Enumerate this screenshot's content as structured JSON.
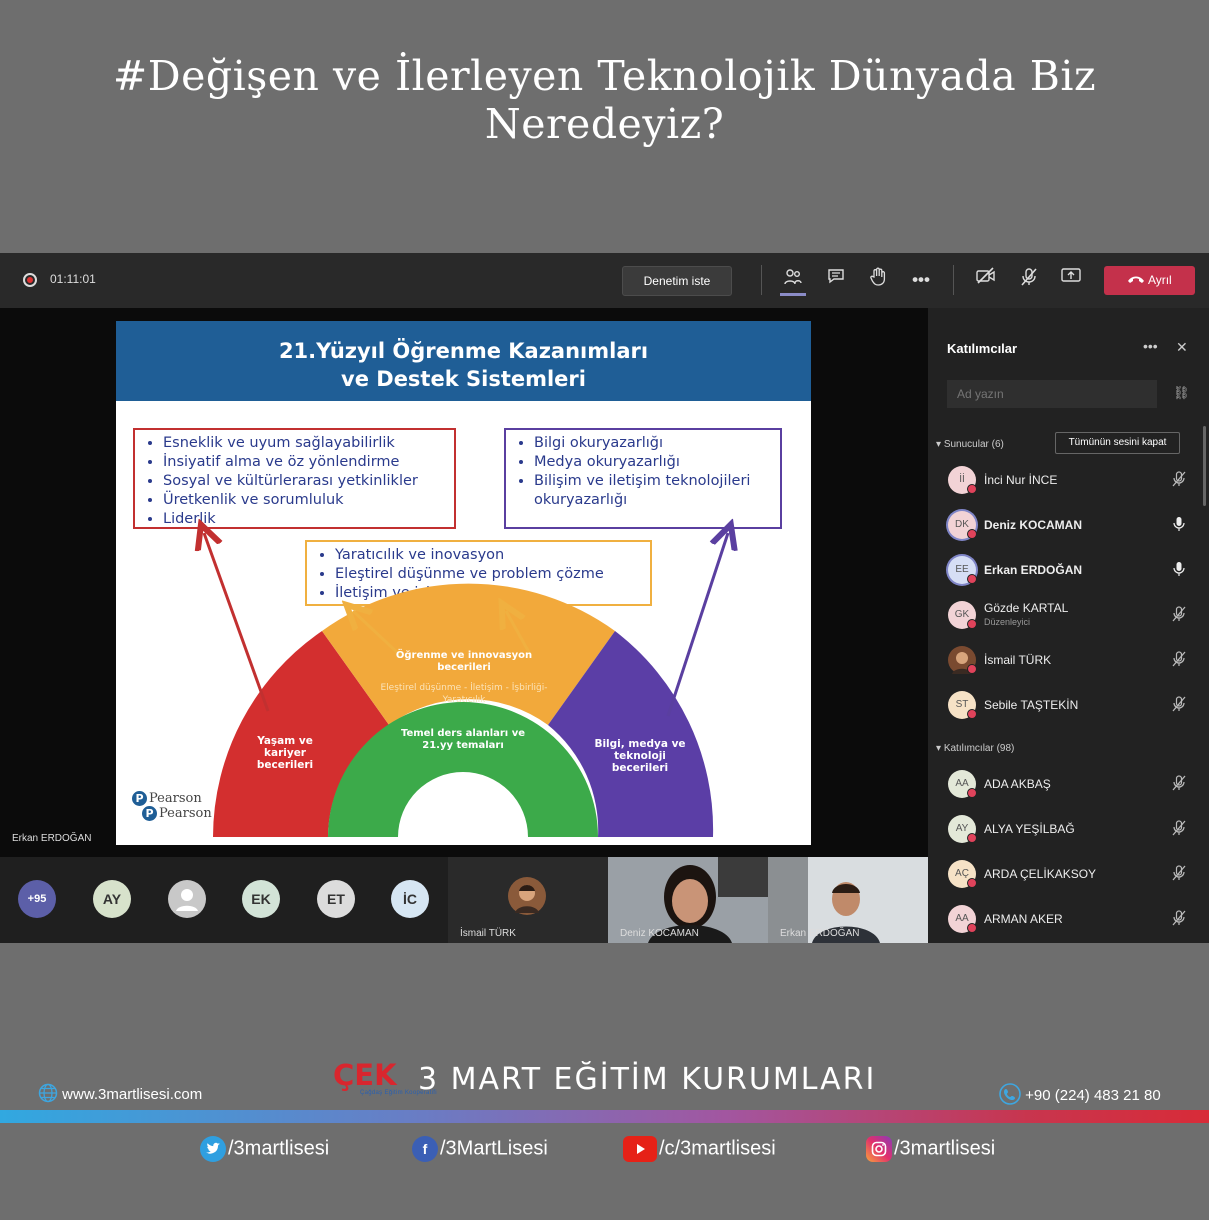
{
  "headline": "#Değişen ve İlerleyen Teknolojik Dünyada Biz Neredeyiz?",
  "meeting": {
    "timer": "01:11:01",
    "control_button": "Denetim iste",
    "leave_label": "Ayrıl",
    "toolbar_icons": [
      "participants-icon",
      "chat-icon",
      "raise-hand-icon",
      "more-icon",
      "camera-off-icon",
      "mic-off-icon",
      "share-screen-icon",
      "phone-hangup-icon"
    ]
  },
  "slide": {
    "title_line1": "21.Yüzyıl Öğrenme Kazanımları",
    "title_line2": "ve Destek Sistemleri",
    "box_red": [
      "Esneklik ve uyum sağlayabilirlik",
      "İnsiyatif alma ve öz yönlendirme",
      "Sosyal ve kültürlerarası yetkinlikler",
      "Üretkenlik ve sorumluluk",
      "Liderlik"
    ],
    "box_purple": [
      "Bilgi okuryazarlığı",
      "Medya okuryazarlığı",
      "Bilişim ve iletişim teknolojileri okuryazarlığı"
    ],
    "box_orange": [
      "Yaratıcılık ve inovasyon",
      "Eleştirel düşünme ve problem çözme",
      "İletişim ve işbirliği"
    ],
    "arc_orange_title": "Öğrenme ve innovasyon becerileri",
    "arc_orange_sub": "Eleştirel düşünme - İletişim - İşbirliği- Yaratıcılık",
    "arc_red": "Yaşam ve kariyer becerileri",
    "arc_green": "Temel ders alanları ve 21.yy temaları",
    "arc_purple": "Bilgi, medya ve teknoloji becerileri",
    "publisher": "Pearson",
    "presenter_label": "Erkan ERDOĞAN"
  },
  "strip": {
    "more_count": "+95",
    "avatars": [
      "AY",
      "",
      "EK",
      "ET",
      "İC"
    ],
    "tiles": [
      "İsmail TÜRK",
      "Deniz KOCAMAN",
      "Erkan ERDOĞAN"
    ]
  },
  "panel": {
    "title": "Katılımcılar",
    "search_placeholder": "Ad yazın",
    "presenters_header": "Sunucular (6)",
    "mute_all": "Tümünün sesini kapat",
    "attendees_header": "Katılımcılar (98)",
    "presenters": [
      {
        "initials": "İİ",
        "name": "İnci Nur İNCE",
        "role": ""
      },
      {
        "initials": "DK",
        "name": "Deniz KOCAMAN",
        "role": ""
      },
      {
        "initials": "EE",
        "name": "Erkan ERDOĞAN",
        "role": ""
      },
      {
        "initials": "GK",
        "name": "Gözde KARTAL",
        "role": "Düzenleyici"
      },
      {
        "initials": "",
        "name": "İsmail TÜRK",
        "role": ""
      },
      {
        "initials": "ST",
        "name": "Sebile TAŞTEKİN",
        "role": ""
      }
    ],
    "attendees": [
      {
        "initials": "AA",
        "name": "ADA AKBAŞ"
      },
      {
        "initials": "AY",
        "name": "ALYA YEŞİLBAĞ"
      },
      {
        "initials": "AÇ",
        "name": "ARDA ÇELİKAKSOY"
      },
      {
        "initials": "AA",
        "name": "ARMAN AKER"
      }
    ]
  },
  "footer": {
    "website": "www.3martlisesi.com",
    "logo_text": "ÇEK",
    "logo_subtext": "Çağdaş Eğitim Kooperatifi",
    "brand": "3 MART EĞİTİM KURUMLARI",
    "phone": "+90 (224) 483 21 80",
    "twitter": "/3martlisesi",
    "facebook": "/3MartLisesi",
    "youtube": "/c/3martlisesi",
    "instagram": "/3martlisesi"
  },
  "colors": {
    "slide_header": "#1f5e96",
    "arc_red": "#d32f2f",
    "arc_orange": "#f2a93b",
    "arc_green": "#3caa4a",
    "arc_purple": "#5b3ea6",
    "leave_button": "#c4314b"
  }
}
